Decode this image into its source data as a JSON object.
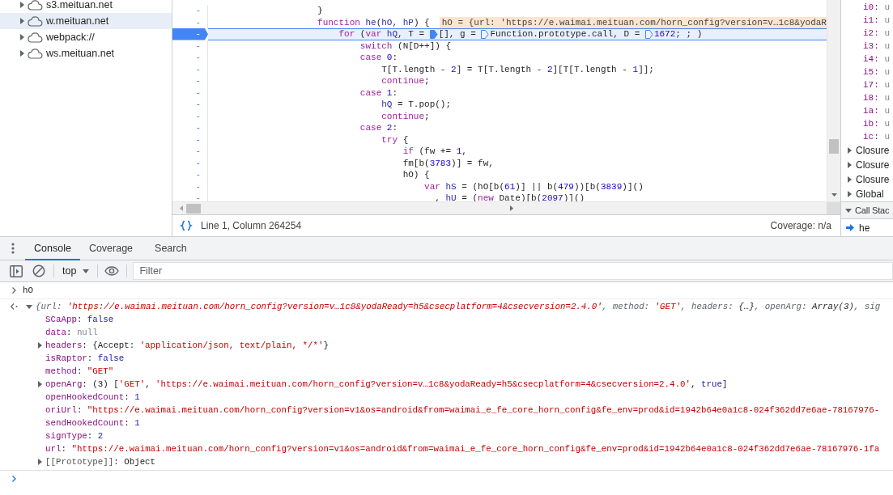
{
  "navigator": {
    "items": [
      {
        "label": "s3.meituan.net",
        "expanded": false,
        "selected": false
      },
      {
        "label": "w.meituan.net",
        "expanded": false,
        "selected": true
      },
      {
        "label": "webpack://",
        "expanded": false,
        "selected": false
      },
      {
        "label": "ws.meituan.net",
        "expanded": false,
        "selected": false
      }
    ]
  },
  "editor": {
    "lines": [
      {
        "gutter": "-",
        "paused": false,
        "segments": [
          {
            "kind": "plain",
            "text": "                    }"
          }
        ]
      },
      {
        "gutter": "-",
        "paused": false,
        "segments": [
          {
            "kind": "keyword",
            "text": "                    function "
          },
          {
            "kind": "variable",
            "text": "he"
          },
          {
            "kind": "plain",
            "text": "("
          },
          {
            "kind": "variable",
            "text": "hO"
          },
          {
            "kind": "plain",
            "text": ", "
          },
          {
            "kind": "variable",
            "text": "hP"
          },
          {
            "kind": "plain",
            "text": ") {"
          },
          {
            "kind": "preview",
            "text": "hO = {url: 'https://e.waimai.meituan.com/horn_config?version=v…1c8&yodaR"
          }
        ]
      },
      {
        "gutter": "-",
        "paused": true,
        "segments": [
          {
            "kind": "keyword",
            "text": "                        for"
          },
          {
            "kind": "plain",
            "text": " ("
          },
          {
            "kind": "keyword",
            "text": "var "
          },
          {
            "kind": "variable",
            "text": "hQ"
          },
          {
            "kind": "plain",
            "text": ", T = "
          },
          {
            "kind": "marker",
            "active": true
          },
          {
            "kind": "plain",
            "text": "[], g = "
          },
          {
            "kind": "marker",
            "active": false
          },
          {
            "kind": "plain",
            "text": "Function.prototype.call, D = "
          },
          {
            "kind": "marker",
            "active": false
          },
          {
            "kind": "number",
            "text": "1672"
          },
          {
            "kind": "plain",
            "text": "; ; )"
          }
        ]
      },
      {
        "gutter": "-",
        "paused": false,
        "segments": [
          {
            "kind": "keyword",
            "text": "                            switch"
          },
          {
            "kind": "plain",
            "text": " (N[D++]) {"
          }
        ]
      },
      {
        "gutter": "-",
        "paused": false,
        "segments": [
          {
            "kind": "keyword",
            "text": "                            case "
          },
          {
            "kind": "number",
            "text": "0"
          },
          {
            "kind": "plain",
            "text": ":"
          }
        ]
      },
      {
        "gutter": "-",
        "paused": false,
        "segments": [
          {
            "kind": "plain",
            "text": "                                T[T.length - "
          },
          {
            "kind": "number",
            "text": "2"
          },
          {
            "kind": "plain",
            "text": "] = T[T.length - "
          },
          {
            "kind": "number",
            "text": "2"
          },
          {
            "kind": "plain",
            "text": "][T[T.length - "
          },
          {
            "kind": "number",
            "text": "1"
          },
          {
            "kind": "plain",
            "text": "]];"
          }
        ]
      },
      {
        "gutter": "-",
        "paused": false,
        "segments": [
          {
            "kind": "keyword",
            "text": "                                continue"
          },
          {
            "kind": "plain",
            "text": ";"
          }
        ]
      },
      {
        "gutter": "-",
        "paused": false,
        "segments": [
          {
            "kind": "keyword",
            "text": "                            case "
          },
          {
            "kind": "number",
            "text": "1"
          },
          {
            "kind": "plain",
            "text": ":"
          }
        ]
      },
      {
        "gutter": "-",
        "paused": false,
        "segments": [
          {
            "kind": "variable",
            "text": "                                hQ"
          },
          {
            "kind": "plain",
            "text": " = T.pop();"
          }
        ]
      },
      {
        "gutter": "-",
        "paused": false,
        "segments": [
          {
            "kind": "keyword",
            "text": "                                continue"
          },
          {
            "kind": "plain",
            "text": ";"
          }
        ]
      },
      {
        "gutter": "-",
        "paused": false,
        "segments": [
          {
            "kind": "keyword",
            "text": "                            case "
          },
          {
            "kind": "number",
            "text": "2"
          },
          {
            "kind": "plain",
            "text": ":"
          }
        ]
      },
      {
        "gutter": "-",
        "paused": false,
        "segments": [
          {
            "kind": "keyword",
            "text": "                                try"
          },
          {
            "kind": "plain",
            "text": " {"
          }
        ]
      },
      {
        "gutter": "-",
        "paused": false,
        "segments": [
          {
            "kind": "keyword",
            "text": "                                    if"
          },
          {
            "kind": "plain",
            "text": " (fw += "
          },
          {
            "kind": "number",
            "text": "1"
          },
          {
            "kind": "plain",
            "text": ","
          }
        ]
      },
      {
        "gutter": "-",
        "paused": false,
        "segments": [
          {
            "kind": "plain",
            "text": "                                    fm[b("
          },
          {
            "kind": "number",
            "text": "3783"
          },
          {
            "kind": "plain",
            "text": ")] = fw,"
          }
        ]
      },
      {
        "gutter": "-",
        "paused": false,
        "segments": [
          {
            "kind": "plain",
            "text": "                                    hO) {"
          }
        ]
      },
      {
        "gutter": "-",
        "paused": false,
        "segments": [
          {
            "kind": "keyword",
            "text": "                                        var "
          },
          {
            "kind": "variable",
            "text": "hS"
          },
          {
            "kind": "plain",
            "text": " = (hO[b("
          },
          {
            "kind": "number",
            "text": "61"
          },
          {
            "kind": "plain",
            "text": ")] || b("
          },
          {
            "kind": "number",
            "text": "479"
          },
          {
            "kind": "plain",
            "text": "))[b("
          },
          {
            "kind": "number",
            "text": "3839"
          },
          {
            "kind": "plain",
            "text": ")]()"
          }
        ]
      },
      {
        "gutter": "-",
        "paused": false,
        "segments": [
          {
            "kind": "plain",
            "text": "                                          , "
          },
          {
            "kind": "variable",
            "text": "hU"
          },
          {
            "kind": "plain",
            "text": " = ("
          },
          {
            "kind": "keyword",
            "text": "new"
          },
          {
            "kind": "plain",
            "text": " Date)[b("
          },
          {
            "kind": "number",
            "text": "2097"
          },
          {
            "kind": "plain",
            "text": ")]()"
          }
        ]
      }
    ],
    "status": {
      "position": "Line 1, Column 264254",
      "coverage": "Coverage: n/a"
    }
  },
  "scope": {
    "variables": [
      {
        "name": "i0:",
        "value": "u"
      },
      {
        "name": "i1:",
        "value": "u"
      },
      {
        "name": "i2:",
        "value": "u"
      },
      {
        "name": "i3:",
        "value": "u"
      },
      {
        "name": "i4:",
        "value": "u"
      },
      {
        "name": "i5:",
        "value": "u"
      },
      {
        "name": "i7:",
        "value": "u"
      },
      {
        "name": "i8:",
        "value": "u"
      },
      {
        "name": "ia:",
        "value": "u"
      },
      {
        "name": "ib:",
        "value": "u"
      },
      {
        "name": "ic:",
        "value": "u"
      }
    ],
    "groups": [
      {
        "label": "Closure",
        "expanded": false
      },
      {
        "label": "Closure",
        "expanded": false
      },
      {
        "label": "Closure",
        "expanded": false
      },
      {
        "label": "Global",
        "expanded": false
      }
    ]
  },
  "call_stack": {
    "title": "Call Stac",
    "expanded": true,
    "frames": [
      {
        "label": "he"
      }
    ]
  },
  "drawer": {
    "tabs": [
      {
        "label": "Console",
        "selected": true
      },
      {
        "label": "Coverage",
        "selected": false
      },
      {
        "label": "Search",
        "selected": false
      }
    ],
    "context": "top",
    "filter": {
      "placeholder": "Filter"
    }
  },
  "console": {
    "entries": [
      {
        "kind": "input",
        "segments": [
          {
            "kind": "plain",
            "text": "hO"
          }
        ]
      },
      {
        "kind": "result",
        "expanded": true,
        "segments": [
          {
            "kind": "label",
            "text": "{url: "
          },
          {
            "kind": "string",
            "text": "'https://e.waimai.meituan.com/horn_config?version=v…1c8&yodaReady=h5&csecplatform=4&csecversion=2.4.0'"
          },
          {
            "kind": "label",
            "text": ", method: "
          },
          {
            "kind": "string",
            "text": "'GET'"
          },
          {
            "kind": "label",
            "text": ", headers: "
          },
          {
            "kind": "plain",
            "text": "{…}"
          },
          {
            "kind": "label",
            "text": ", openArg: "
          },
          {
            "kind": "plain",
            "text": "Array(3)"
          },
          {
            "kind": "label",
            "text": ", sig"
          }
        ]
      },
      {
        "kind": "property",
        "segments": [
          {
            "kind": "key",
            "text": "SCaApp"
          },
          {
            "kind": "plain",
            "text": ": "
          },
          {
            "kind": "literal",
            "text": "false"
          }
        ]
      },
      {
        "kind": "property",
        "segments": [
          {
            "kind": "key",
            "text": "data"
          },
          {
            "kind": "plain",
            "text": ": "
          },
          {
            "kind": "null",
            "text": "null"
          }
        ]
      },
      {
        "kind": "property_node",
        "expanded": false,
        "segments": [
          {
            "kind": "key",
            "text": "headers"
          },
          {
            "kind": "plain",
            "text": ": {Accept: "
          },
          {
            "kind": "string",
            "text": "'application/json, text/plain, */*'"
          },
          {
            "kind": "plain",
            "text": "}"
          }
        ]
      },
      {
        "kind": "property",
        "segments": [
          {
            "kind": "key",
            "text": "isRaptor"
          },
          {
            "kind": "plain",
            "text": ": "
          },
          {
            "kind": "literal",
            "text": "false"
          }
        ]
      },
      {
        "kind": "property",
        "segments": [
          {
            "kind": "key",
            "text": "method"
          },
          {
            "kind": "plain",
            "text": ": "
          },
          {
            "kind": "string",
            "text": "\"GET\""
          }
        ]
      },
      {
        "kind": "property_node",
        "expanded": false,
        "segments": [
          {
            "kind": "key",
            "text": "openArg"
          },
          {
            "kind": "plain",
            "text": ": (3) ["
          },
          {
            "kind": "string",
            "text": "'GET'"
          },
          {
            "kind": "plain",
            "text": ", "
          },
          {
            "kind": "string",
            "text": "'https://e.waimai.meituan.com/horn_config?version=v…1c8&yodaReady=h5&csecplatform=4&csecversion=2.4.0'"
          },
          {
            "kind": "plain",
            "text": ", "
          },
          {
            "kind": "literal",
            "text": "true"
          },
          {
            "kind": "plain",
            "text": "]"
          }
        ]
      },
      {
        "kind": "property",
        "segments": [
          {
            "kind": "key",
            "text": "openHookedCount"
          },
          {
            "kind": "plain",
            "text": ": "
          },
          {
            "kind": "literal",
            "text": "1"
          }
        ]
      },
      {
        "kind": "property",
        "segments": [
          {
            "kind": "key",
            "text": "oriUrl"
          },
          {
            "kind": "plain",
            "text": ": "
          },
          {
            "kind": "string",
            "text": "\"https://e.waimai.meituan.com/horn_config?version=v1&os=android&from=waimai_e_fe_core_horn_config&fe_env=prod&id=1942b64e0a1c8-024f362dd7e6ae-78167976-"
          }
        ]
      },
      {
        "kind": "property",
        "segments": [
          {
            "kind": "key",
            "text": "sendHookedCount"
          },
          {
            "kind": "plain",
            "text": ": "
          },
          {
            "kind": "literal",
            "text": "1"
          }
        ]
      },
      {
        "kind": "property",
        "segments": [
          {
            "kind": "key",
            "text": "signType"
          },
          {
            "kind": "plain",
            "text": ": "
          },
          {
            "kind": "literal",
            "text": "2"
          }
        ]
      },
      {
        "kind": "property",
        "segments": [
          {
            "kind": "key",
            "text": "url"
          },
          {
            "kind": "plain",
            "text": ": "
          },
          {
            "kind": "string",
            "text": "\"https://e.waimai.meituan.com/horn_config?version=v1&os=android&from=waimai_e_fe_core_horn_config&fe_env=prod&id=1942b64e0a1c8-024f362dd7e6ae-78167976-1fa"
          }
        ]
      },
      {
        "kind": "property_node",
        "expanded": false,
        "segments": [
          {
            "kind": "internal",
            "text": "[[Prototype]]"
          },
          {
            "kind": "plain",
            "text": ": Object"
          }
        ]
      },
      {
        "kind": "prompt"
      }
    ]
  }
}
